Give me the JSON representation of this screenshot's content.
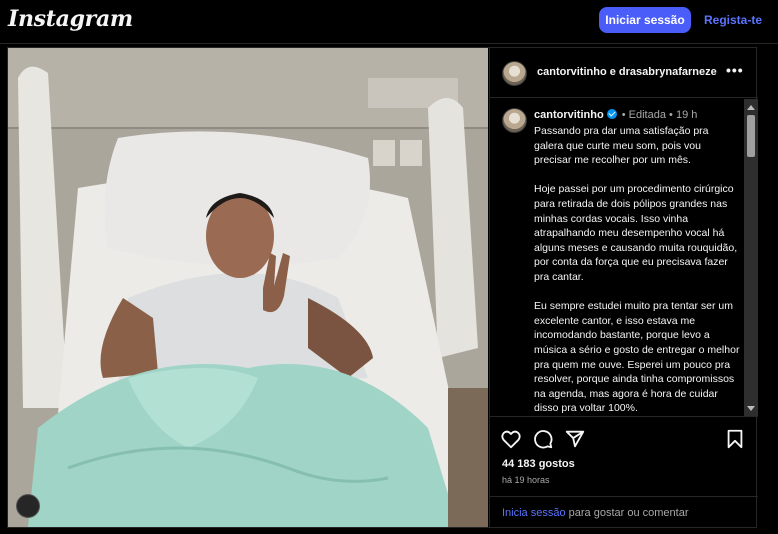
{
  "header": {
    "logo": "Instagram",
    "login_label": "Iniciar sessão",
    "signup_label": "Regista-te"
  },
  "post": {
    "authors": "cantorvitinho e drasabrynafarneze",
    "more_label": "•••",
    "caption": {
      "username": "cantorvitinho",
      "edited": "Editada",
      "separator": "•",
      "time": "19 h",
      "paragraphs": [
        "Passando pra dar uma satisfação pra galera que curte meu som, pois vou precisar me recolher por um mês.",
        "Hoje passei por um procedimento cirúrgico para retirada de dois pólipos grandes nas minhas cordas vocais. Isso vinha atrapalhando meu desempenho vocal há alguns meses e causando muita rouquidão, por conta da força que eu precisava fazer pra cantar.",
        "Eu sempre estudei muito pra tentar ser um excelente cantor, e isso estava me incomodando bastante, porque levo a música a sério e gosto de entregar o melhor pra quem me ouve. Esperei um pouco pra resolver, porque ainda tinha compromissos na agenda, mas agora é hora de cuidar disso pra voltar 100%."
      ]
    },
    "likes": "44 183 gostos",
    "time_ago": "há 19 horas",
    "footer": {
      "login_link": "Inicia sessão",
      "rest": " para gostar ou comentar"
    }
  },
  "icons": {
    "like": "heart-icon",
    "comment": "comment-icon",
    "share": "send-icon",
    "save": "bookmark-icon"
  },
  "colors": {
    "accent": "#4a5df9",
    "link": "#5a74ff",
    "verified": "#0095f6",
    "background": "#000000"
  }
}
